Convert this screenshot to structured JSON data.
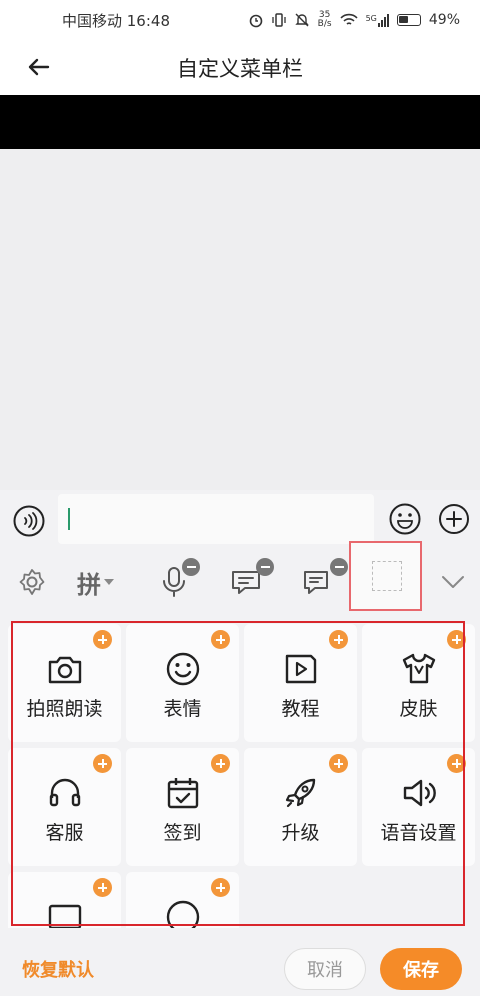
{
  "status_bar": {
    "carrier_time": "中国移动 16:48",
    "net_speed_top": "35",
    "net_speed_bottom": "B/s",
    "signal_label": "5G",
    "battery": "49%",
    "icons": [
      "alarm-icon",
      "vibrate-icon",
      "mute-icon",
      "wifi-icon",
      "signal-icon",
      "battery-icon"
    ]
  },
  "nav": {
    "title": "自定义菜单栏"
  },
  "toolbar": {
    "pinyin_label": "拼",
    "items": [
      "settings-icon",
      "pinyin-switch",
      "mic-icon",
      "friend-chat-icon",
      "quick-phrase-icon",
      "empty-slot",
      "collapse-chevron-icon"
    ]
  },
  "menu_items": [
    {
      "label": "拍照朗读",
      "icon": "camera-icon"
    },
    {
      "label": "表情",
      "icon": "smiley-icon"
    },
    {
      "label": "教程",
      "icon": "tutorial-play-icon"
    },
    {
      "label": "皮肤",
      "icon": "tshirt-skin-icon"
    },
    {
      "label": "客服",
      "icon": "headset-icon"
    },
    {
      "label": "签到",
      "icon": "calendar-check-icon"
    },
    {
      "label": "升级",
      "icon": "rocket-icon"
    },
    {
      "label": "语音设置",
      "icon": "speaker-icon"
    }
  ],
  "bottom": {
    "restore_label": "恢复默认",
    "cancel_label": "取消",
    "save_label": "保存"
  },
  "colors": {
    "accent": "#f58b28",
    "badge": "#f3963a",
    "highlight_red": "#d9262c",
    "panel_bg": "#f2f2f4"
  }
}
